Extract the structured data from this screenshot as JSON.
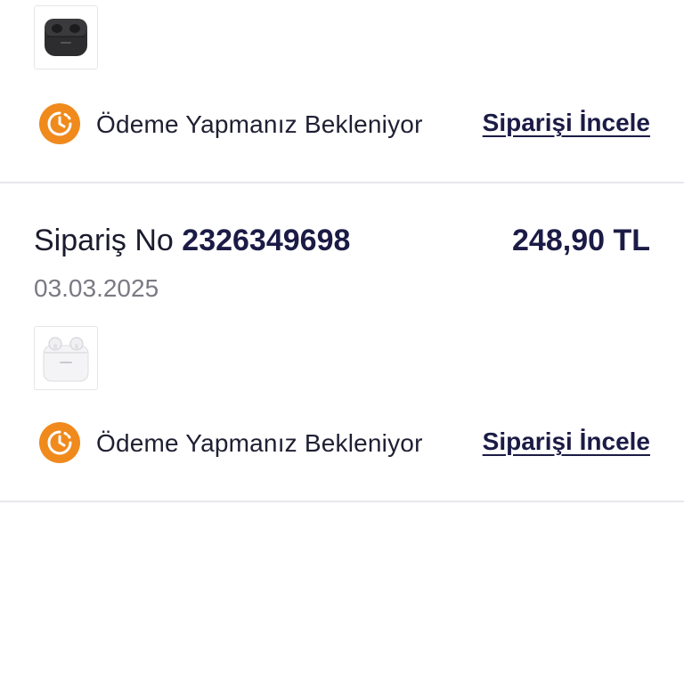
{
  "orders": [
    {
      "product_icon": "black-earbuds-case",
      "status_icon": "clock-icon",
      "status_text": "Ödeme Yapmanız Bekleniyor",
      "review_link": "Siparişi İncele"
    },
    {
      "order_label": "Sipariş No",
      "order_number": "2326349698",
      "total": "248,90 TL",
      "date": "03.03.2025",
      "product_icon": "white-earbuds-case",
      "status_icon": "clock-icon",
      "status_text": "Ödeme Yapmanız Bekleniyor",
      "review_link": "Siparişi İncele"
    }
  ],
  "colors": {
    "status_orange": "#f08a1c",
    "link_navy": "#1b1b46",
    "divider": "#e8e8ec",
    "muted_text": "#7a7a84"
  }
}
